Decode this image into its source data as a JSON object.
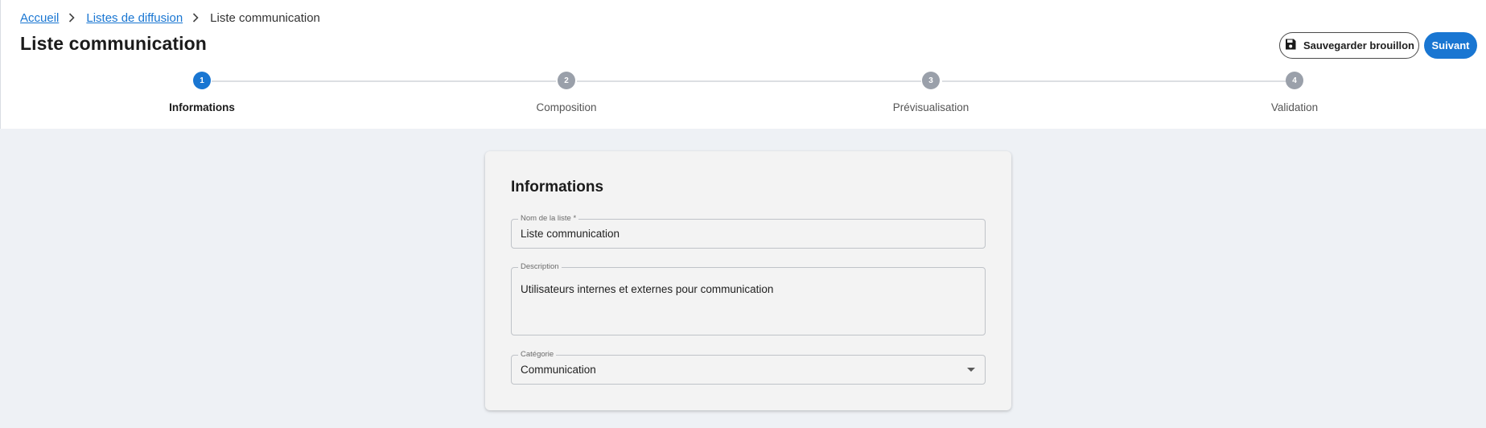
{
  "breadcrumb": {
    "items": [
      "Accueil",
      "Listes de diffusion"
    ],
    "current": "Liste communication"
  },
  "header": {
    "title": "Liste communication",
    "draft_button": "Sauvegarder brouillon",
    "next_button": "Suivant"
  },
  "stepper": {
    "steps": [
      {
        "number": "1",
        "label": "Informations",
        "active": true
      },
      {
        "number": "2",
        "label": "Composition",
        "active": false
      },
      {
        "number": "3",
        "label": "Prévisualisation",
        "active": false
      },
      {
        "number": "4",
        "label": "Validation",
        "active": false
      }
    ]
  },
  "form": {
    "title": "Informations",
    "name_label": "Nom de la liste *",
    "name_value": "Liste communication",
    "description_label": "Description",
    "description_value": "Utilisateurs internes et externes pour communication",
    "category_label": "Catégorie",
    "category_value": "Communication"
  },
  "icons": {
    "draft": "save-icon",
    "separator": "chevron-right-icon",
    "select": "caret-down-icon"
  },
  "colors": {
    "accent": "#1976d2",
    "inactive_step": "#9aa0aa",
    "background": "#eef1f5"
  }
}
